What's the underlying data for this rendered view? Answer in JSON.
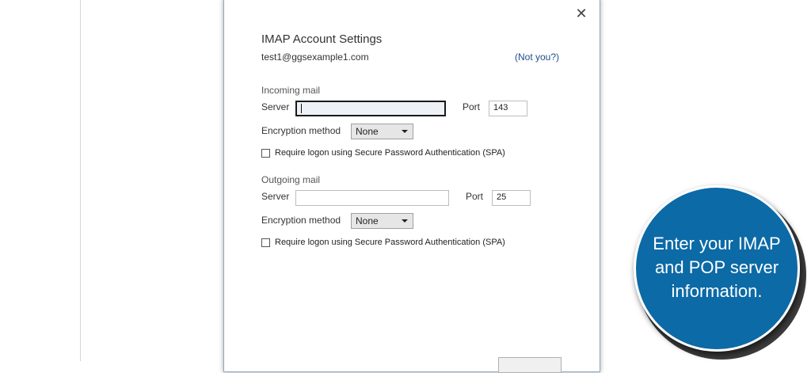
{
  "dialog": {
    "title": "IMAP Account Settings",
    "account": "test1@ggsexample1.com",
    "not_you": "(Not you?)",
    "close_icon": "close-icon"
  },
  "incoming": {
    "section": "Incoming mail",
    "server_label": "Server",
    "server_value": "",
    "port_label": "Port",
    "port_value": "143",
    "encryption_label": "Encryption method",
    "encryption_value": "None",
    "spa_label": "Require logon using Secure Password Authentication (SPA)",
    "spa_checked": false
  },
  "outgoing": {
    "section": "Outgoing mail",
    "server_label": "Server",
    "server_value": "",
    "port_label": "Port",
    "port_value": "25",
    "encryption_label": "Encryption method",
    "encryption_value": "None",
    "spa_label": "Require logon using Secure Password Authentication (SPA)",
    "spa_checked": false
  },
  "callout": {
    "line1": "Enter your IMAP",
    "line2": "and POP server",
    "line3": "information.",
    "color": "#0c6aa6"
  }
}
